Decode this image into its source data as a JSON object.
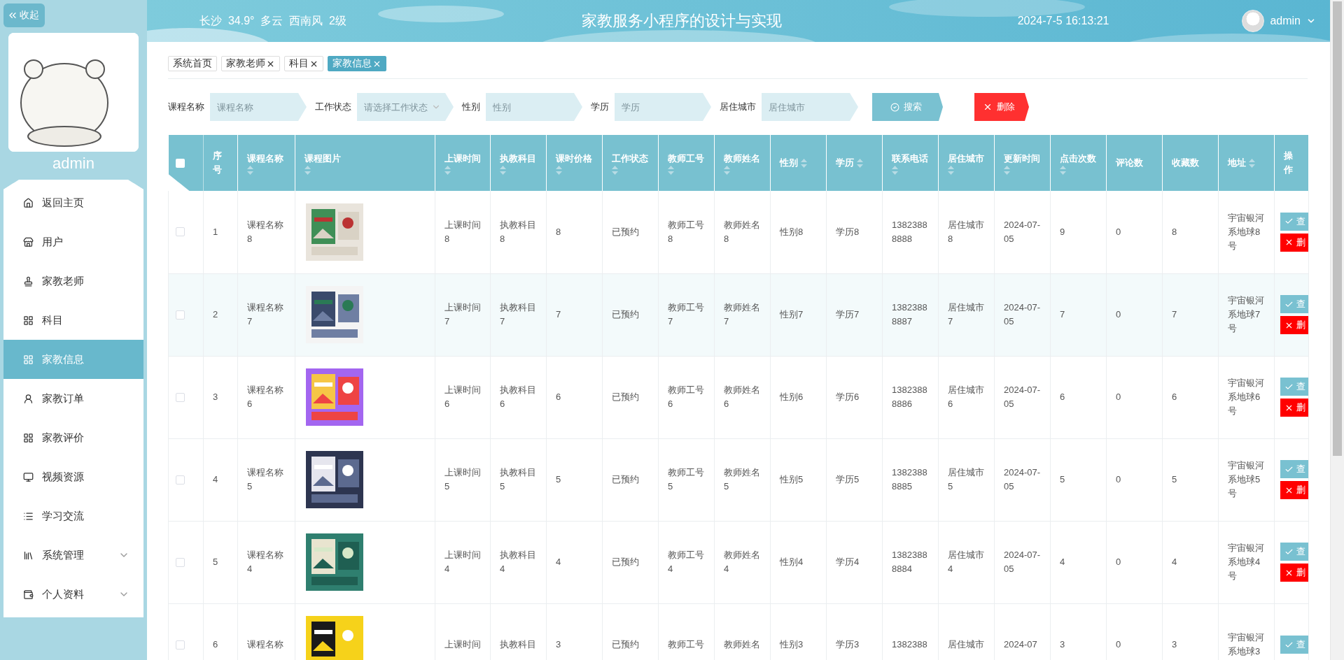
{
  "sidebar": {
    "collapse_button": "收起",
    "username": "admin",
    "menu": [
      {
        "label": "返回主页",
        "selected": false,
        "expandable": false
      },
      {
        "label": "用户",
        "selected": false,
        "expandable": false
      },
      {
        "label": "家教老师",
        "selected": false,
        "expandable": false
      },
      {
        "label": "科目",
        "selected": false,
        "expandable": false
      },
      {
        "label": "家教信息",
        "selected": true,
        "expandable": false
      },
      {
        "label": "家教订单",
        "selected": false,
        "expandable": false
      },
      {
        "label": "家教评价",
        "selected": false,
        "expandable": false
      },
      {
        "label": "视频资源",
        "selected": false,
        "expandable": false
      },
      {
        "label": "学习交流",
        "selected": false,
        "expandable": false
      },
      {
        "label": "系统管理",
        "selected": false,
        "expandable": true
      },
      {
        "label": "个人资料",
        "selected": false,
        "expandable": true
      }
    ]
  },
  "header": {
    "weather": "长沙  34.9°  多云  西南风  2级",
    "title": "家教服务小程序的设计与实现",
    "datetime": "2024-7-5 16:13:21",
    "user": "admin"
  },
  "tabs": [
    {
      "label": "系统首页",
      "selected": false,
      "closable": false
    },
    {
      "label": "家教老师",
      "selected": false,
      "closable": true
    },
    {
      "label": "科目",
      "selected": false,
      "closable": true
    },
    {
      "label": "家教信息",
      "selected": true,
      "closable": true
    }
  ],
  "filters": [
    {
      "label": "课程名称",
      "kind": "input",
      "placeholder": "课程名称"
    },
    {
      "label": "工作状态",
      "kind": "select",
      "placeholder": "请选择工作状态"
    },
    {
      "label": "性别",
      "kind": "input",
      "placeholder": "性别"
    },
    {
      "label": "学历",
      "kind": "input",
      "placeholder": "学历"
    },
    {
      "label": "居住城市",
      "kind": "input",
      "placeholder": "居住城市"
    }
  ],
  "search_button": "搜索",
  "delete_button": "删除",
  "table": {
    "select_all": {
      "checked": false
    },
    "columns": [
      {
        "label": "序号",
        "sortable": false
      },
      {
        "label": "课程名称",
        "sortable": true
      },
      {
        "label": "课程图片",
        "sortable": true
      },
      {
        "label": "上课时间",
        "sortable": true
      },
      {
        "label": "执教科目",
        "sortable": true
      },
      {
        "label": "课时价格",
        "sortable": true
      },
      {
        "label": "工作状态",
        "sortable": true
      },
      {
        "label": "教师工号",
        "sortable": true
      },
      {
        "label": "教师姓名",
        "sortable": true
      },
      {
        "label": "性别",
        "sortable": true
      },
      {
        "label": "学历",
        "sortable": true
      },
      {
        "label": "联系电话",
        "sortable": true
      },
      {
        "label": "居住城市",
        "sortable": true
      },
      {
        "label": "更新时间",
        "sortable": true
      },
      {
        "label": "点击次数",
        "sortable": true
      },
      {
        "label": "评论数",
        "sortable": false
      },
      {
        "label": "收藏数",
        "sortable": false
      },
      {
        "label": "地址",
        "sortable": true
      },
      {
        "label": "操作",
        "sortable": false
      }
    ],
    "rows": [
      {
        "checked": false,
        "highlighted": false,
        "index": "1",
        "name": "课程名称8",
        "image": {
          "kind": "picture"
        },
        "time": "上课时间8",
        "subject": "执教科目8",
        "price": "8",
        "status": "已预约",
        "teacher_no": "教师工号8",
        "teacher_name": "教师姓名8",
        "gender": "性别8",
        "education": "学历8",
        "phone": "13823888888",
        "city": "居住城市8",
        "updated": "2024-07-05",
        "clicks": "9",
        "comments": "0",
        "favorites": "8",
        "address": "宇宙银河系地球8号",
        "actions": [
          {
            "kind": "view",
            "label": "查"
          },
          {
            "kind": "delete",
            "label": "删"
          }
        ]
      },
      {
        "checked": false,
        "highlighted": true,
        "index": "2",
        "name": "课程名称7",
        "image": {
          "kind": "picture"
        },
        "time": "上课时间7",
        "subject": "执教科目7",
        "price": "7",
        "status": "已预约",
        "teacher_no": "教师工号7",
        "teacher_name": "教师姓名7",
        "gender": "性别7",
        "education": "学历7",
        "phone": "13823888887",
        "city": "居住城市7",
        "updated": "2024-07-05",
        "clicks": "7",
        "comments": "0",
        "favorites": "7",
        "address": "宇宙银河系地球7号",
        "actions": [
          {
            "kind": "view",
            "label": "查"
          },
          {
            "kind": "delete",
            "label": "删"
          }
        ]
      },
      {
        "checked": false,
        "highlighted": false,
        "index": "3",
        "name": "课程名称6",
        "image": {
          "kind": "picture"
        },
        "time": "上课时间6",
        "subject": "执教科目6",
        "price": "6",
        "status": "已预约",
        "teacher_no": "教师工号6",
        "teacher_name": "教师姓名6",
        "gender": "性别6",
        "education": "学历6",
        "phone": "13823888886",
        "city": "居住城市6",
        "updated": "2024-07-05",
        "clicks": "6",
        "comments": "0",
        "favorites": "6",
        "address": "宇宙银河系地球6号",
        "actions": [
          {
            "kind": "view",
            "label": "查"
          },
          {
            "kind": "delete",
            "label": "删"
          }
        ]
      },
      {
        "checked": false,
        "highlighted": false,
        "index": "4",
        "name": "课程名称5",
        "image": {
          "kind": "picture"
        },
        "time": "上课时间5",
        "subject": "执教科目5",
        "price": "5",
        "status": "已预约",
        "teacher_no": "教师工号5",
        "teacher_name": "教师姓名5",
        "gender": "性别5",
        "education": "学历5",
        "phone": "13823888885",
        "city": "居住城市5",
        "updated": "2024-07-05",
        "clicks": "5",
        "comments": "0",
        "favorites": "5",
        "address": "宇宙银河系地球5号",
        "actions": [
          {
            "kind": "view",
            "label": "查"
          },
          {
            "kind": "delete",
            "label": "删"
          }
        ]
      },
      {
        "checked": false,
        "highlighted": false,
        "index": "5",
        "name": "课程名称4",
        "image": {
          "kind": "picture"
        },
        "time": "上课时间4",
        "subject": "执教科目4",
        "price": "4",
        "status": "已预约",
        "teacher_no": "教师工号4",
        "teacher_name": "教师姓名4",
        "gender": "性别4",
        "education": "学历4",
        "phone": "13823888884",
        "city": "居住城市4",
        "updated": "2024-07-05",
        "clicks": "4",
        "comments": "0",
        "favorites": "4",
        "address": "宇宙银河系地球4号",
        "actions": [
          {
            "kind": "view",
            "label": "查"
          },
          {
            "kind": "delete",
            "label": "删"
          }
        ]
      },
      {
        "checked": false,
        "highlighted": false,
        "index": "6",
        "name": "课程名称",
        "image": {
          "kind": "picture"
        },
        "time": "上课时间",
        "subject": "执教科目",
        "price": "3",
        "status": "已预约",
        "teacher_no": "教师工号",
        "teacher_name": "教师姓名",
        "gender": "性别3",
        "education": "学历3",
        "phone": "1382388",
        "city": "居住城市",
        "updated": "2024-07",
        "clicks": "3",
        "comments": "0",
        "favorites": "3",
        "address": "宇宙银河系地球3",
        "actions": [
          {
            "kind": "view",
            "label": "查"
          }
        ]
      }
    ]
  }
}
